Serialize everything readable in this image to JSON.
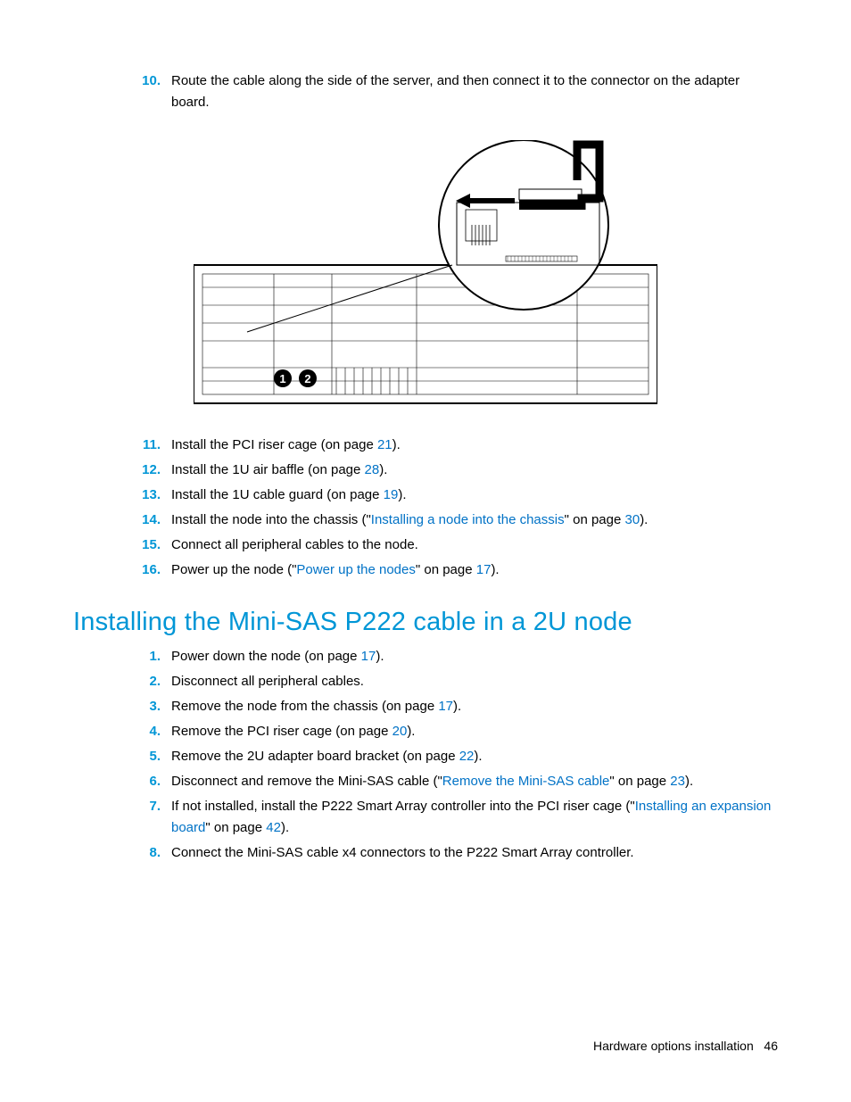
{
  "topSteps": [
    {
      "n": "10",
      "parts": [
        {
          "t": "Route the cable along the side of the server, and then connect it to the connector on the adapter board."
        }
      ]
    },
    {
      "n": "11",
      "parts": [
        {
          "t": "Install the PCI riser cage (on page "
        },
        {
          "t": "21",
          "link": true
        },
        {
          "t": ")."
        }
      ]
    },
    {
      "n": "12",
      "parts": [
        {
          "t": "Install the 1U air baffle (on page "
        },
        {
          "t": "28",
          "link": true
        },
        {
          "t": ")."
        }
      ]
    },
    {
      "n": "13",
      "parts": [
        {
          "t": "Install the 1U cable guard (on page "
        },
        {
          "t": "19",
          "link": true
        },
        {
          "t": ")."
        }
      ]
    },
    {
      "n": "14",
      "parts": [
        {
          "t": "Install the node into the chassis (\""
        },
        {
          "t": "Installing a node into the chassis",
          "link": true
        },
        {
          "t": "\" on page "
        },
        {
          "t": "30",
          "link": true
        },
        {
          "t": ")."
        }
      ]
    },
    {
      "n": "15",
      "parts": [
        {
          "t": "Connect all peripheral cables to the node."
        }
      ]
    },
    {
      "n": "16",
      "parts": [
        {
          "t": "Power up the node (\""
        },
        {
          "t": "Power up the nodes",
          "link": true
        },
        {
          "t": "\" on page "
        },
        {
          "t": "17",
          "link": true
        },
        {
          "t": ")."
        }
      ]
    }
  ],
  "sectionHeading": "Installing the Mini-SAS P222 cable in a 2U node",
  "bottomSteps": [
    {
      "n": "1",
      "parts": [
        {
          "t": "Power down the node (on page "
        },
        {
          "t": "17",
          "link": true
        },
        {
          "t": ")."
        }
      ]
    },
    {
      "n": "2",
      "parts": [
        {
          "t": "Disconnect all peripheral cables."
        }
      ]
    },
    {
      "n": "3",
      "parts": [
        {
          "t": "Remove the node from the chassis (on page "
        },
        {
          "t": "17",
          "link": true
        },
        {
          "t": ")."
        }
      ]
    },
    {
      "n": "4",
      "parts": [
        {
          "t": "Remove the PCI riser cage (on page "
        },
        {
          "t": "20",
          "link": true
        },
        {
          "t": ")."
        }
      ]
    },
    {
      "n": "5",
      "parts": [
        {
          "t": "Remove the 2U adapter board bracket (on page "
        },
        {
          "t": "22",
          "link": true
        },
        {
          "t": ")."
        }
      ]
    },
    {
      "n": "6",
      "parts": [
        {
          "t": "Disconnect and remove the Mini-SAS cable (\""
        },
        {
          "t": "Remove the Mini-SAS cable",
          "link": true
        },
        {
          "t": "\" on page "
        },
        {
          "t": "23",
          "link": true
        },
        {
          "t": ")."
        }
      ]
    },
    {
      "n": "7",
      "parts": [
        {
          "t": "If not installed, install the P222 Smart Array controller into the PCI riser cage (\""
        },
        {
          "t": "Installing an expansion board",
          "link": true
        },
        {
          "t": "\" on page "
        },
        {
          "t": "42",
          "link": true
        },
        {
          "t": ")."
        }
      ]
    },
    {
      "n": "8",
      "parts": [
        {
          "t": "Connect the Mini-SAS cable x4 connectors to the P222 Smart Array controller."
        }
      ]
    }
  ],
  "footerSection": "Hardware options installation",
  "footerPage": "46"
}
